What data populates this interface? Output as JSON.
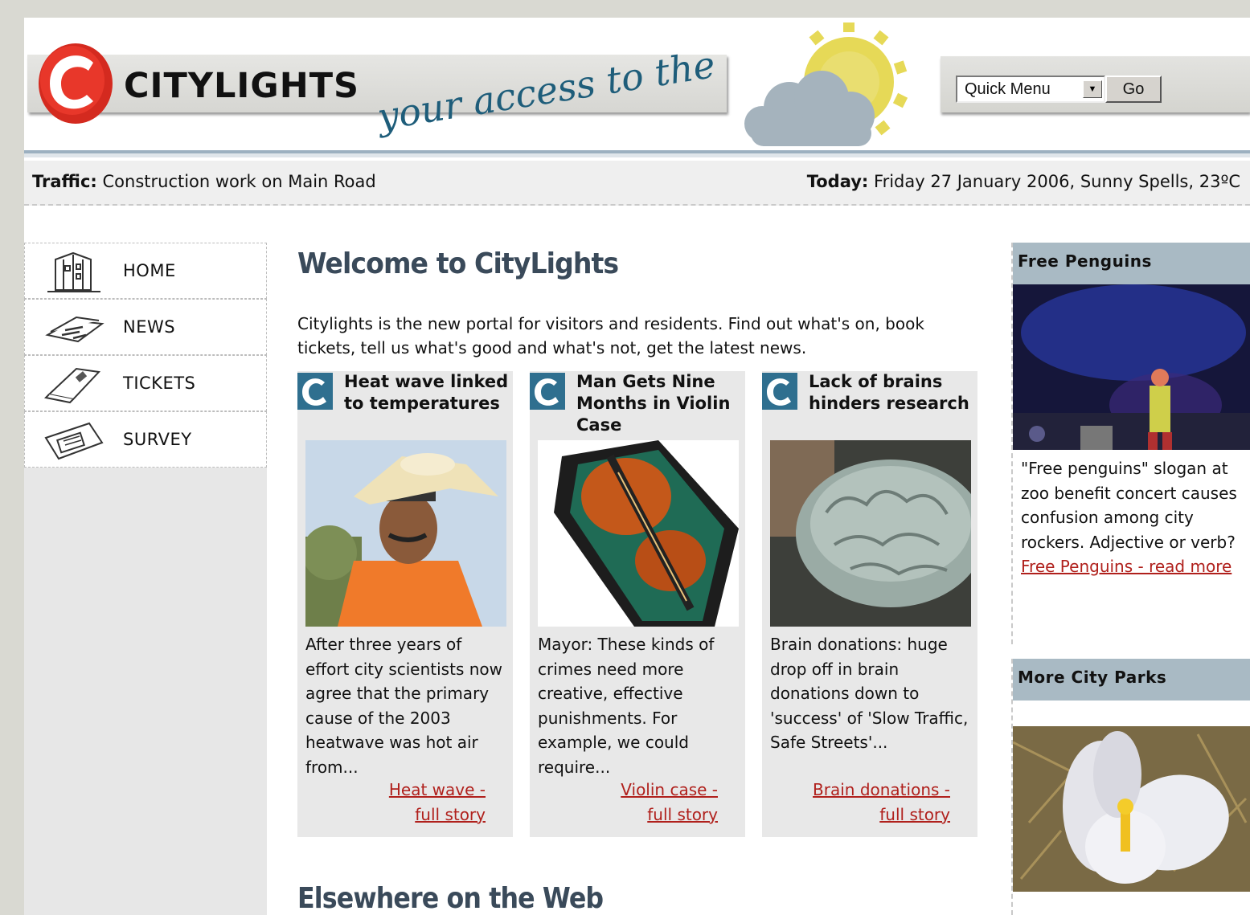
{
  "header": {
    "logo_text": "CITYLIGHTS",
    "slogan": "your access to the city",
    "quick_menu": {
      "selected": "Quick Menu",
      "go_label": "Go"
    }
  },
  "infobar": {
    "traffic_label": "Traffic:",
    "traffic_text": "Construction work on Main Road",
    "today_label": "Today:",
    "today_text": "Friday 27 January 2006, Sunny Spells, 23ºC"
  },
  "nav": {
    "items": [
      {
        "label": "HOME",
        "icon": "building-icon"
      },
      {
        "label": "NEWS",
        "icon": "newspaper-icon"
      },
      {
        "label": "TICKETS",
        "icon": "ticket-icon"
      },
      {
        "label": "SURVEY",
        "icon": "survey-icon"
      }
    ]
  },
  "main": {
    "title": "Welcome to CityLights",
    "intro": "Citylights is the new portal for visitors and residents. Find out what's on, book tickets, tell us what's good and what's not, get the latest news.",
    "cards": [
      {
        "title": "Heat wave linked to temperatures",
        "text": "After three years of effort city scientists now agree that the primary cause of the 2003 heatwave was hot air from...",
        "link_line1": "Heat wave -",
        "link_line2": "full story"
      },
      {
        "title": "Man Gets Nine Months in Violin Case",
        "text": "Mayor: These kinds of crimes need more creative, effective punishments. For example, we could require...",
        "link_line1": "Violin case -",
        "link_line2": "full story"
      },
      {
        "title": "Lack of brains hinders research",
        "text": "Brain donations: huge drop off in brain donations down to 'success' of 'Slow Traffic, Safe Streets'...",
        "link_line1": "Brain donations -",
        "link_line2": "full story"
      }
    ],
    "elsewhere_title": "Elsewhere on the Web"
  },
  "sidebar_right": {
    "panels": [
      {
        "heading": "Free Penguins",
        "text": "\"Free penguins\" slogan at zoo benefit concert causes confusion among city rockers. Adjective or verb?",
        "link": "Free Penguins - read more"
      },
      {
        "heading": "More City Parks"
      }
    ]
  },
  "colors": {
    "brand_red": "#d42a1f",
    "heading_slate": "#3a4a5a",
    "panel_head": "#a9bac4",
    "link_red": "#b0201c",
    "sun_yellow": "#e6d957",
    "cloud_grey": "#a5b3bd"
  }
}
